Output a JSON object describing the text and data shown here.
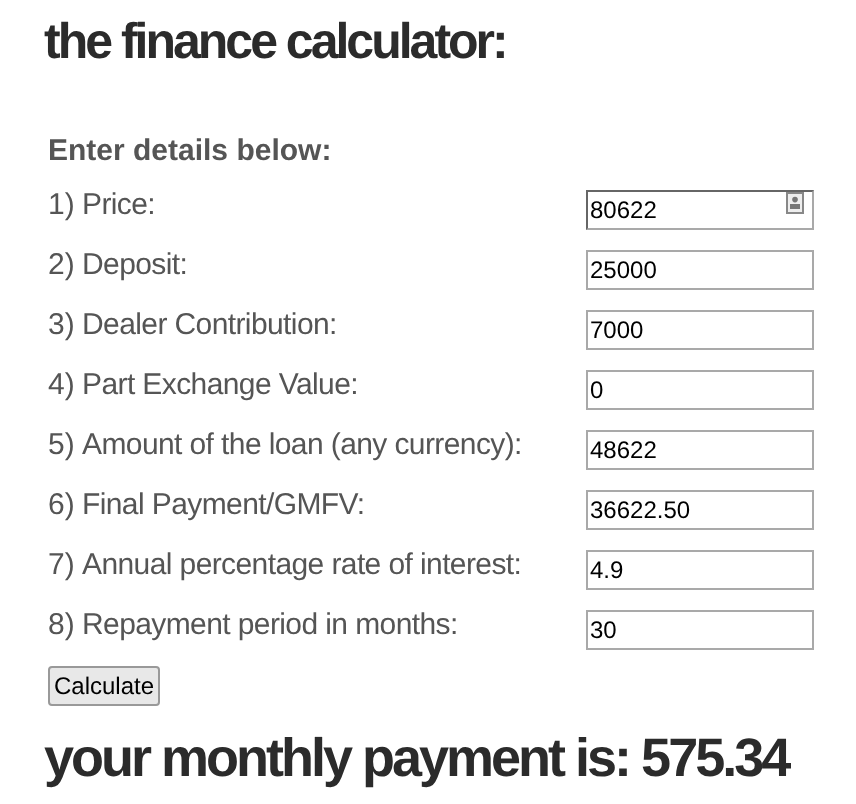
{
  "title": "the finance calculator:",
  "form_heading": "Enter details below:",
  "fields": [
    {
      "number": "1)",
      "label": "Price:",
      "value": "80622",
      "autofill_icon": true
    },
    {
      "number": "2)",
      "label": "Deposit:",
      "value": "25000",
      "autofill_icon": false
    },
    {
      "number": "3)",
      "label": "Dealer Contribution:",
      "value": "7000",
      "autofill_icon": false
    },
    {
      "number": "4)",
      "label": "Part Exchange Value:",
      "value": "0",
      "autofill_icon": false
    },
    {
      "number": "5)",
      "label": "Amount of the loan (any currency):",
      "value": "48622",
      "autofill_icon": false
    },
    {
      "number": "6)",
      "label": "Final Payment/GMFV:",
      "value": "36622.50",
      "autofill_icon": false
    },
    {
      "number": "7)",
      "label": "Annual percentage rate of interest:",
      "value": "4.9",
      "autofill_icon": false
    },
    {
      "number": "8)",
      "label": "Repayment period in months:",
      "value": "30",
      "autofill_icon": false
    }
  ],
  "button": "Calculate",
  "result": "your monthly payment is: 575.34"
}
